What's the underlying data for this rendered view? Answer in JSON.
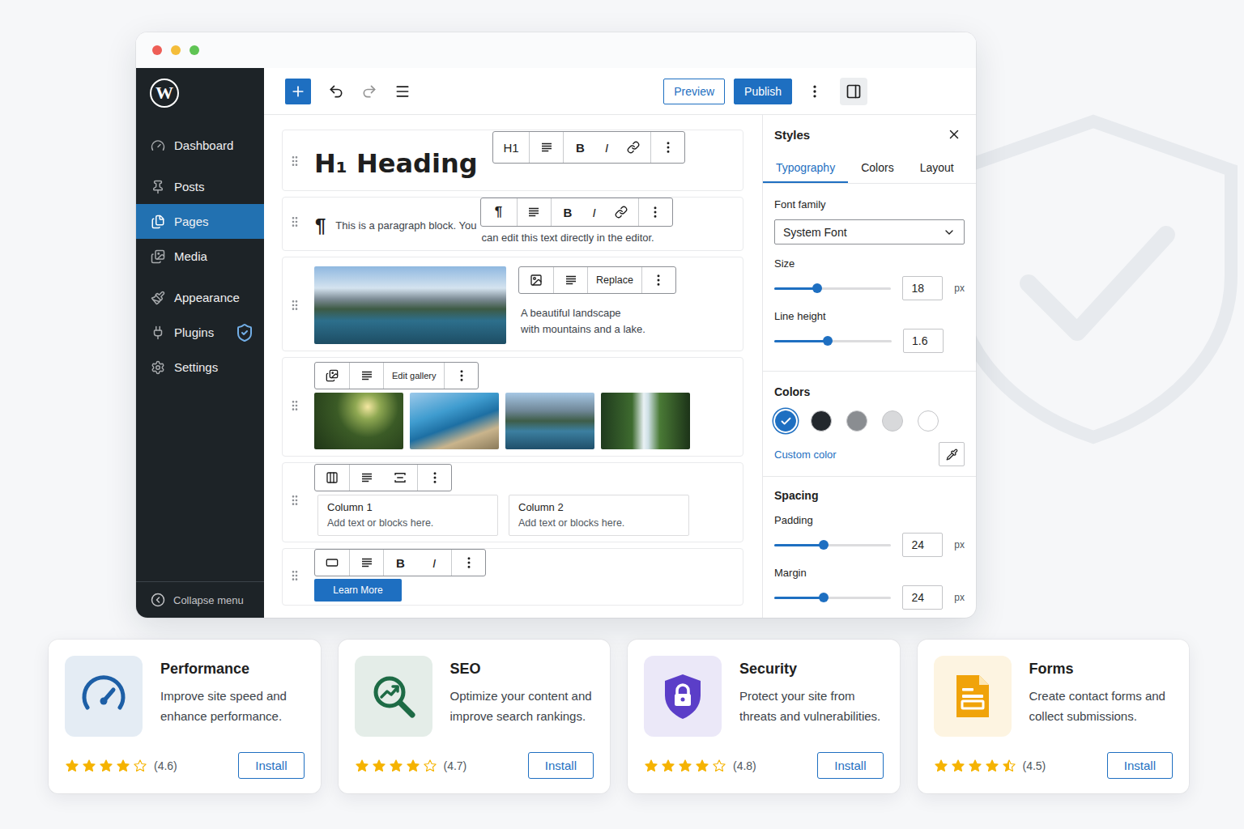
{
  "sidebar": {
    "logo": "W",
    "groups": [
      [
        {
          "label": "Dashboard",
          "selected": false,
          "badge": false
        }
      ],
      [
        {
          "label": "Posts",
          "selected": false,
          "badge": false
        },
        {
          "label": "Pages",
          "selected": true,
          "badge": false
        },
        {
          "label": "Media",
          "selected": false,
          "badge": false
        }
      ],
      [
        {
          "label": "Appearance",
          "selected": false,
          "badge": false
        },
        {
          "label": "Plugins",
          "selected": false,
          "badge": true
        },
        {
          "label": "Settings",
          "selected": false,
          "badge": false
        }
      ]
    ],
    "collapse": "Collapse menu"
  },
  "top_bar": {
    "preview": "Preview",
    "publish": "Publish"
  },
  "editor": {
    "heading": {
      "text": "H₁ Heading",
      "toolbar": {
        "level": "H1",
        "bold": "B",
        "italic": "I"
      }
    },
    "paragraph": {
      "mark": "¶",
      "lines": [
        "This is a paragraph block. You",
        "can edit this text directly in the editor."
      ],
      "toolbar": {
        "mark": "¶",
        "bold": "B",
        "italic": "I"
      }
    },
    "image": {
      "caption": [
        "A beautiful landscape",
        "with mountains and a lake."
      ],
      "toolbar": {
        "action": "Replace"
      }
    },
    "gallery": {
      "toolbar": {
        "action": "Edit gallery"
      }
    },
    "columns": [
      {
        "title": "Column 1",
        "hint": "Add text or blocks here."
      },
      {
        "title": "Column 2",
        "hint": "Add text or blocks here."
      }
    ],
    "button": {
      "label": "Learn More",
      "toolbar": {
        "bold": "B",
        "italic": "I"
      }
    }
  },
  "styles_panel": {
    "title": "Styles",
    "tabs": [
      {
        "label": "Typography",
        "selected": true
      },
      {
        "label": "Colors",
        "selected": false
      },
      {
        "label": "Layout",
        "selected": false
      }
    ],
    "typography": {
      "font_family_label": "Font family",
      "font_family": "System Font",
      "controls": [
        {
          "label": "Size",
          "level": 0.37,
          "value": "18",
          "unit": "px"
        },
        {
          "label": "Line height",
          "level": 0.455,
          "value": "1.6"
        }
      ]
    },
    "colors": {
      "title": "Colors",
      "swatches": [
        {
          "color": "#1e6fc1",
          "selected": true
        },
        {
          "color": "#23282d",
          "selected": false
        },
        {
          "color": "#8a8d91",
          "selected": false
        },
        {
          "color": "#d8d9db",
          "selected": false
        },
        {
          "color": "#ffffff",
          "selected": false
        }
      ],
      "custom": "Custom color"
    },
    "spacing": {
      "title": "Spacing",
      "controls": [
        {
          "label": "Padding",
          "level": 0.42,
          "value": "24",
          "unit": "px"
        },
        {
          "label": "Margin",
          "level": 0.42,
          "value": "24",
          "unit": "px"
        }
      ]
    }
  },
  "plugins": [
    {
      "name": "Performance",
      "description": "Improve site speed and enhance performance.",
      "stars": 4,
      "rating": "(4.6)",
      "action": "Install",
      "color": "#1d5fa6"
    },
    {
      "name": "SEO",
      "description": "Optimize your content and improve search rankings.",
      "stars": 4,
      "rating": "(4.7)",
      "action": "Install",
      "color": "#1d6b45"
    },
    {
      "name": "Security",
      "description": "Protect your site from threats and vulnerabilities.",
      "stars": 4,
      "rating": "(4.8)",
      "action": "Install",
      "color": "#5b3ec8"
    },
    {
      "name": "Forms",
      "description": "Create contact forms and collect submissions.",
      "stars": 4.5,
      "rating": "(4.5)",
      "action": "Install",
      "color": "#f0a30a"
    }
  ]
}
